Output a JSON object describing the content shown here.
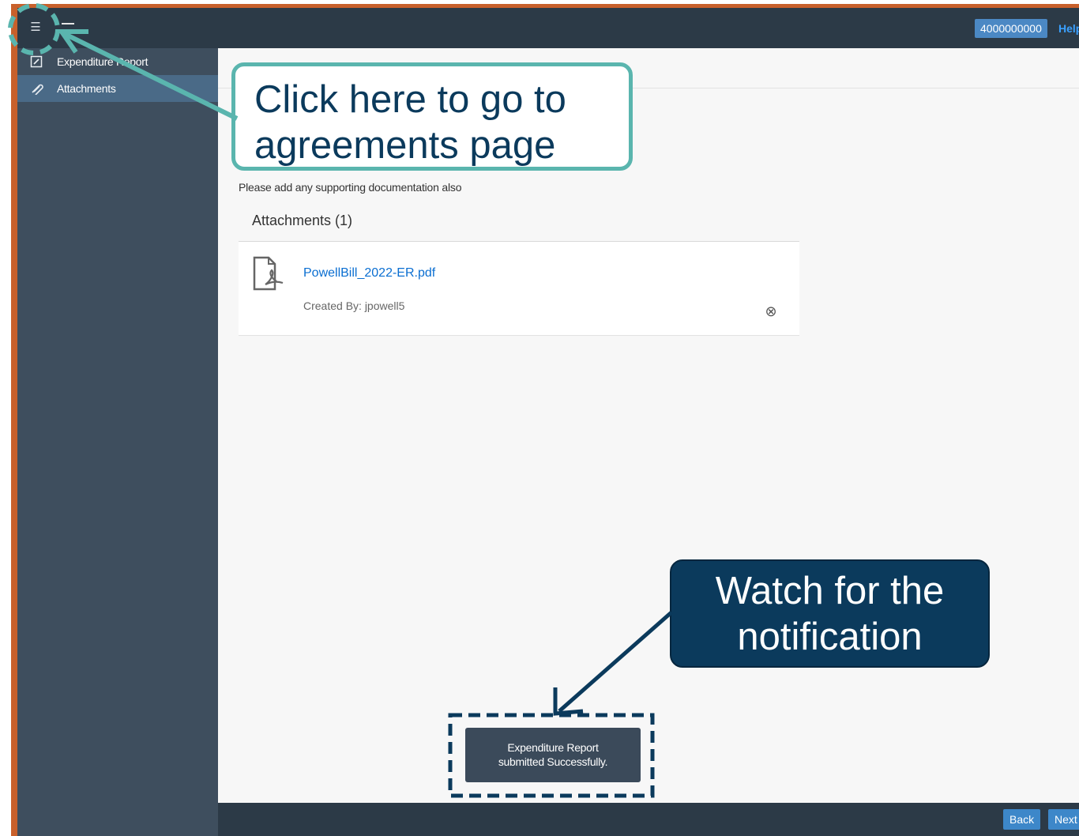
{
  "shell": {
    "menu_icon": "list-icon",
    "account_id": "4000000000",
    "help_label": "Help"
  },
  "sidebar": {
    "items": [
      {
        "label": "Expenditure Report",
        "icon": "edit-icon",
        "active": false
      },
      {
        "label": "Attachments",
        "icon": "paperclip-icon",
        "active": true
      }
    ]
  },
  "main": {
    "description": "Please add any supporting documentation also",
    "attachments": {
      "title": "Attachments (1)",
      "files": [
        {
          "name": "PowellBill_2022-ER.pdf",
          "created_by": "Created By: jpowell5",
          "icon": "pdf-icon"
        }
      ]
    }
  },
  "toast": {
    "line1": "Expenditure Report",
    "line2": "submitted Successfully."
  },
  "footer": {
    "back_label": "Back",
    "next_label": "Next"
  },
  "annotations": {
    "callout_top": {
      "line1": "Click here to go to",
      "line2": "agreements page",
      "border_color": "#5ab5ae",
      "text_color": "#0b3a5c"
    },
    "callout_bottom": {
      "line1": "Watch for the",
      "line2": "notification",
      "fill_color": "#0b3a5c"
    }
  },
  "colors": {
    "shellbar": "#2c3a47",
    "sidebar": "#3e4e5e",
    "sidebar_active": "#4a6a87",
    "accent": "#3d87c9",
    "link": "#0a6ed1",
    "frame": "#c8602b"
  }
}
